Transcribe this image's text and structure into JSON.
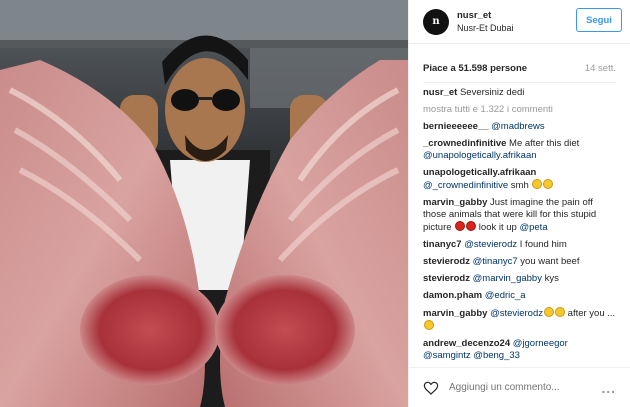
{
  "header": {
    "username": "nusr_et",
    "location": "Nusr-Et Dubai",
    "follow_label": "Segui",
    "avatar_initial": "n"
  },
  "stats": {
    "likes": "Piace a 51.598 persone",
    "time": "14 sett."
  },
  "caption": {
    "user": "nusr_et",
    "text": " Seversiniz dedi"
  },
  "more_comments": "mostra tutti e 1.322 i commenti",
  "comments": [
    {
      "user": "bernieeeeee__",
      "pre": " ",
      "mention": "@madbrews",
      "post": ""
    },
    {
      "user": "_crownedinfinitive",
      "pre": " Me after this diet ",
      "mention": "@unapologetically.afrikaan",
      "post": ""
    },
    {
      "user": "unapologetically.afrikaan",
      "pre": " ",
      "mention": "@_crownedinfinitive",
      "post": " smh"
    },
    {
      "user": "marvin_gabby",
      "pre": " Just imagine the pain off those animals that were kill for this stupid picture ",
      "mention": "@peta",
      "post": " look it up "
    },
    {
      "user": "tinanyc7",
      "pre": " ",
      "mention": "@stevierodz",
      "post": " I found him"
    },
    {
      "user": "stevierodz",
      "pre": " ",
      "mention": "@tinanyc7",
      "post": " you want beef"
    },
    {
      "user": "stevierodz",
      "pre": " ",
      "mention": "@marvin_gabby",
      "post": " kys"
    },
    {
      "user": "damon.pham",
      "pre": " ",
      "mention": "@edric_a",
      "post": ""
    },
    {
      "user": "marvin_gabby",
      "pre": " ",
      "mention": "@stevierodz",
      "post": " after you ... "
    },
    {
      "user": "andrew_decenzo24",
      "pre": " ",
      "mention": "@jgorneegor @samgintz @beng_33",
      "post": ""
    }
  ],
  "footer": {
    "placeholder": "Aggiungi un commento...",
    "more": "..."
  },
  "colors": {
    "link": "#003569",
    "follow": "#3897f0",
    "meta": "#999999"
  },
  "icons": {
    "like": "heart-icon",
    "options": "more-options-icon"
  }
}
